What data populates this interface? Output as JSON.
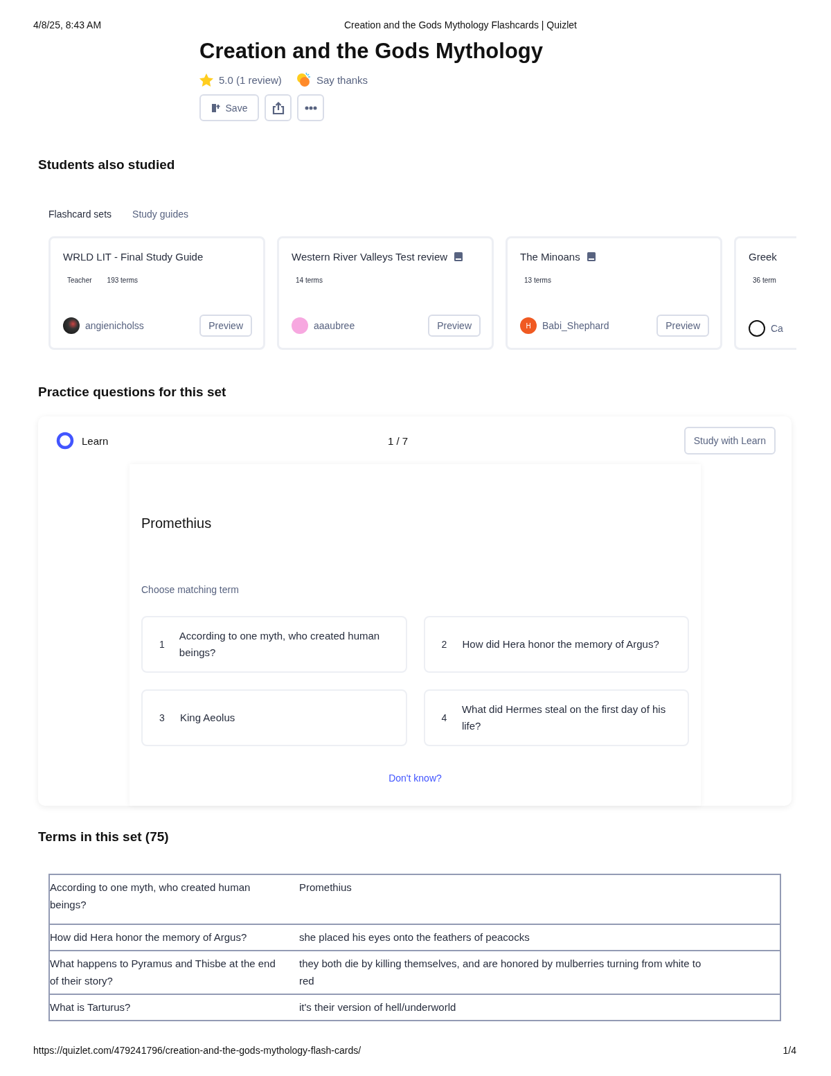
{
  "print_header": {
    "date": "4/8/25, 8:43 AM",
    "page_title": "Creation and the Gods Mythology Flashcards | Quizlet"
  },
  "set": {
    "title": "Creation and the Gods Mythology",
    "rating": "5.0 (1 review)",
    "thanks": "Say thanks",
    "save": "Save"
  },
  "also_studied": {
    "heading": "Students also studied",
    "tabs": [
      {
        "label": "Flashcard sets",
        "selected": true
      },
      {
        "label": "Study guides",
        "selected": false
      }
    ],
    "cards": [
      {
        "title": "WRLD LIT - Final Study Guide",
        "book_icon": false,
        "meta": [
          "Teacher",
          "193 terms"
        ],
        "user": "angienicholss",
        "avatar": {
          "kind": "photo"
        },
        "preview": "Preview"
      },
      {
        "title": "Western River Valleys Test review",
        "book_icon": true,
        "meta": [
          "14 terms"
        ],
        "user": "aaaubree",
        "avatar": {
          "kind": "pink"
        },
        "preview": "Preview"
      },
      {
        "title": "The Minoans",
        "book_icon": true,
        "meta": [
          "13 terms"
        ],
        "user": "Babi_Shephard",
        "avatar": {
          "kind": "letter",
          "letter": "H"
        },
        "preview": "Preview"
      },
      {
        "title": "Greek",
        "book_icon": false,
        "meta": [
          "36 term"
        ],
        "user": "Ca",
        "avatar": {
          "kind": "mascot"
        }
      }
    ]
  },
  "practice": {
    "heading": "Practice questions for this set",
    "mode": "Learn",
    "progress": "1 / 7",
    "study_button": "Study with Learn",
    "prompt": "Promethius",
    "instruction": "Choose matching term",
    "options": [
      {
        "number": "1",
        "text": "According to one myth, who created human beings?"
      },
      {
        "number": "2",
        "text": "How did Hera honor the memory of Argus?"
      },
      {
        "number": "3",
        "text": "King Aeolus"
      },
      {
        "number": "4",
        "text": "What did Hermes steal on the first day of his life?"
      }
    ],
    "dont_know": "Don't know?"
  },
  "terms": {
    "heading": "Terms in this set (75)",
    "rows": [
      {
        "term": "According to one myth, who created human beings?",
        "definition": "Promethius"
      },
      {
        "term": "How did Hera honor the memory of Argus?",
        "definition": "she placed his eyes onto the feathers of peacocks"
      },
      {
        "term": "What happens to Pyramus and Thisbe at the end of their story?",
        "definition": "they both die by killing themselves, and are honored by mulberries turning from white to red"
      },
      {
        "term": "What is Tarturus?",
        "definition": "it's their version of hell/underworld"
      }
    ]
  },
  "print_footer": {
    "url": "https://quizlet.com/479241796/creation-and-the-gods-mythology-flash-cards/",
    "page": "1/4"
  }
}
